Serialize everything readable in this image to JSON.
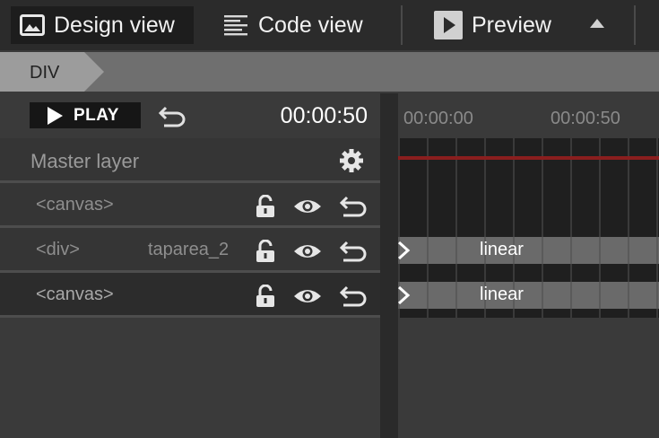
{
  "toolbar": {
    "design_view": "Design view",
    "code_view": "Code view",
    "preview": "Preview"
  },
  "breadcrumb": {
    "current": "DIV"
  },
  "transport": {
    "play_label": "PLAY",
    "time": "00:00:50"
  },
  "layers": {
    "master": "Master layer",
    "rows": [
      {
        "name": "<canvas>",
        "extra": ""
      },
      {
        "name": "<div>",
        "extra": "taparea_2"
      },
      {
        "name": "<canvas>",
        "extra": ""
      }
    ]
  },
  "timeline": {
    "ticks": [
      "00:00:00",
      "00:00:50"
    ],
    "tracks": [
      {
        "easing": "linear"
      },
      {
        "easing": "linear"
      }
    ]
  },
  "colors": {
    "playhead": "#8a1e1e",
    "toolbar_bg": "#2b2b2b",
    "breadcrumb_bg": "#6f6f6f"
  }
}
